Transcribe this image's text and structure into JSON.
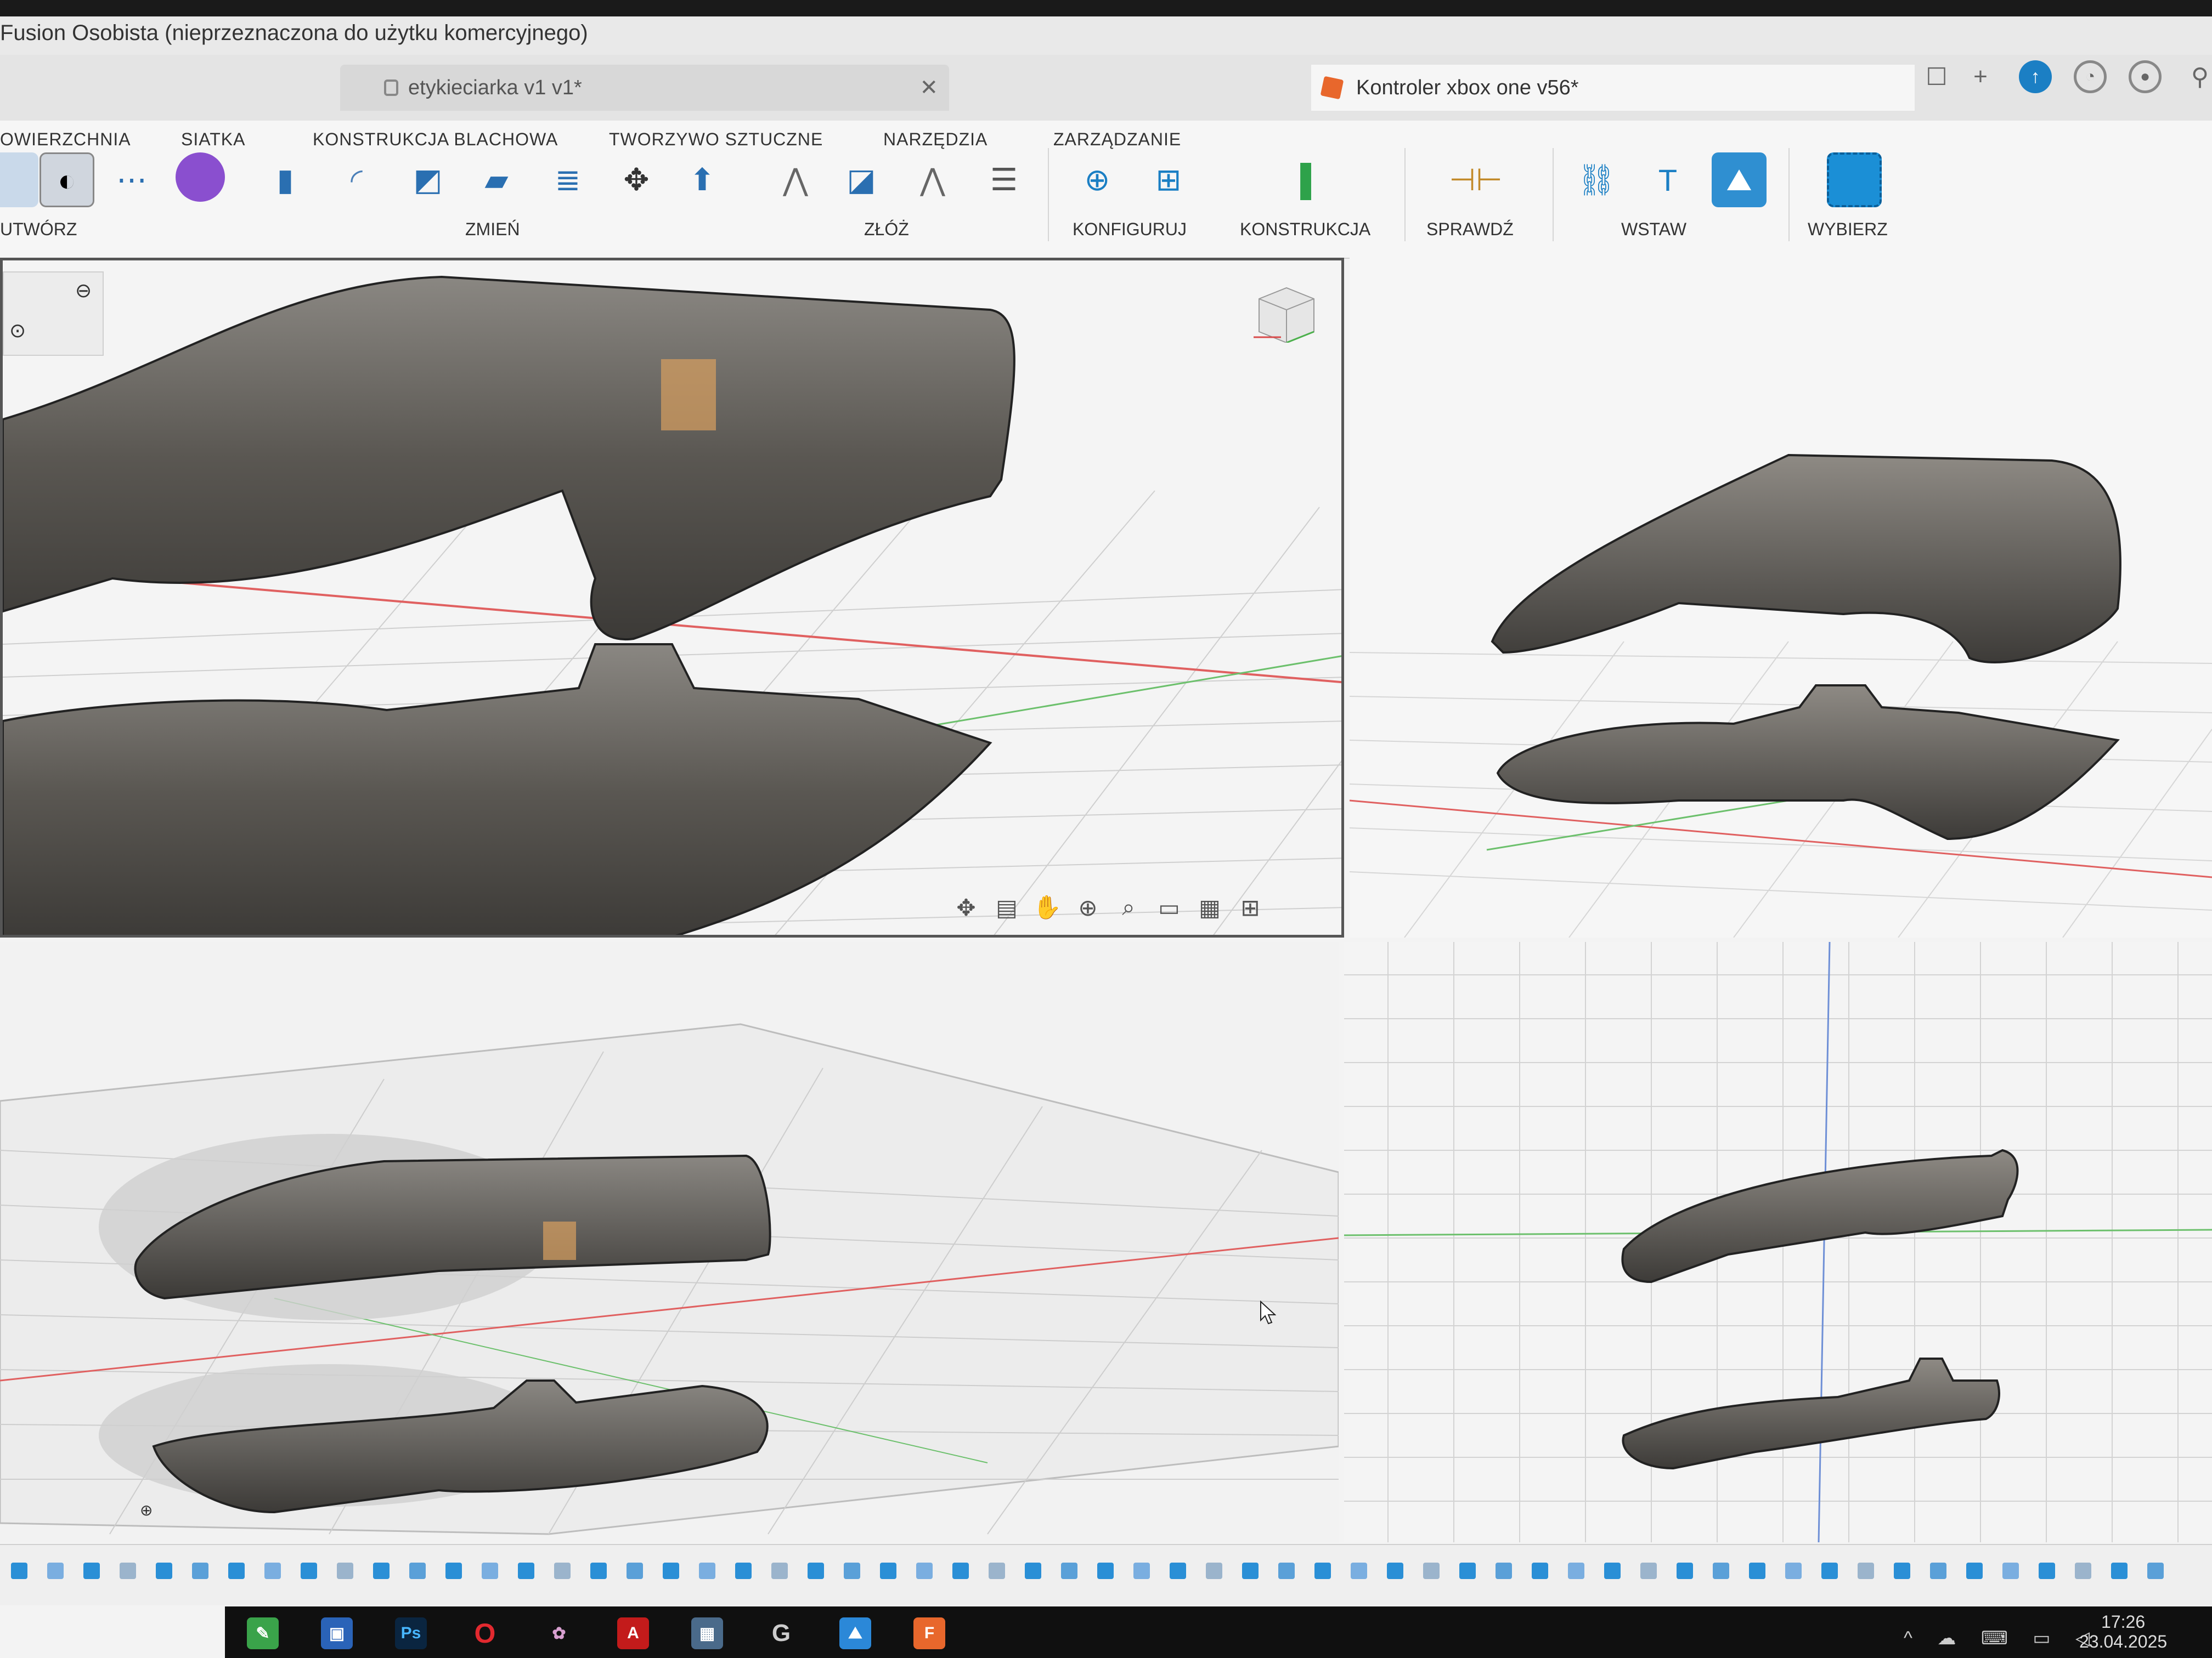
{
  "window": {
    "app_title": "Fusion Osobista (nieprzeznaczona do użytku komercyjnego)"
  },
  "tabs": [
    {
      "label": "etykieciarka v1 v1*",
      "active": false
    },
    {
      "label": "Kontroler xbox one v56*",
      "active": true
    }
  ],
  "ribbon": {
    "tabs": [
      "OWIERZCHNIA",
      "SIATKA",
      "KONSTRUKCJA BLACHOWA",
      "TWORZYWO SZTUCZNE",
      "NARZĘDZIA",
      "ZARZĄDZANIE"
    ],
    "groups": {
      "create": "UTWÓRZ",
      "modify": "ZMIEŃ",
      "assemble": "ZŁÓŻ",
      "configure": "KONFIGURUJ",
      "construct": "KONSTRUKCJA",
      "inspect": "SPRAWDŹ",
      "insert": "WSTAW",
      "select": "WYBIERZ"
    }
  },
  "taskbar": {
    "apps": [
      "Fusion Osobista",
      "Zapisz",
      "Ps",
      "Opera",
      "Paint",
      "Acrobat",
      "Kalkulator",
      "G",
      "Zdjęcia",
      "Fusion"
    ],
    "time": "17:26",
    "date": "23.04.2025"
  },
  "colors": {
    "accent": "#0696d7",
    "active_tab_icon": "#e8672c",
    "x_axis": "#d94b4b",
    "y_axis": "#4bb04b",
    "model": "#5a5752"
  }
}
